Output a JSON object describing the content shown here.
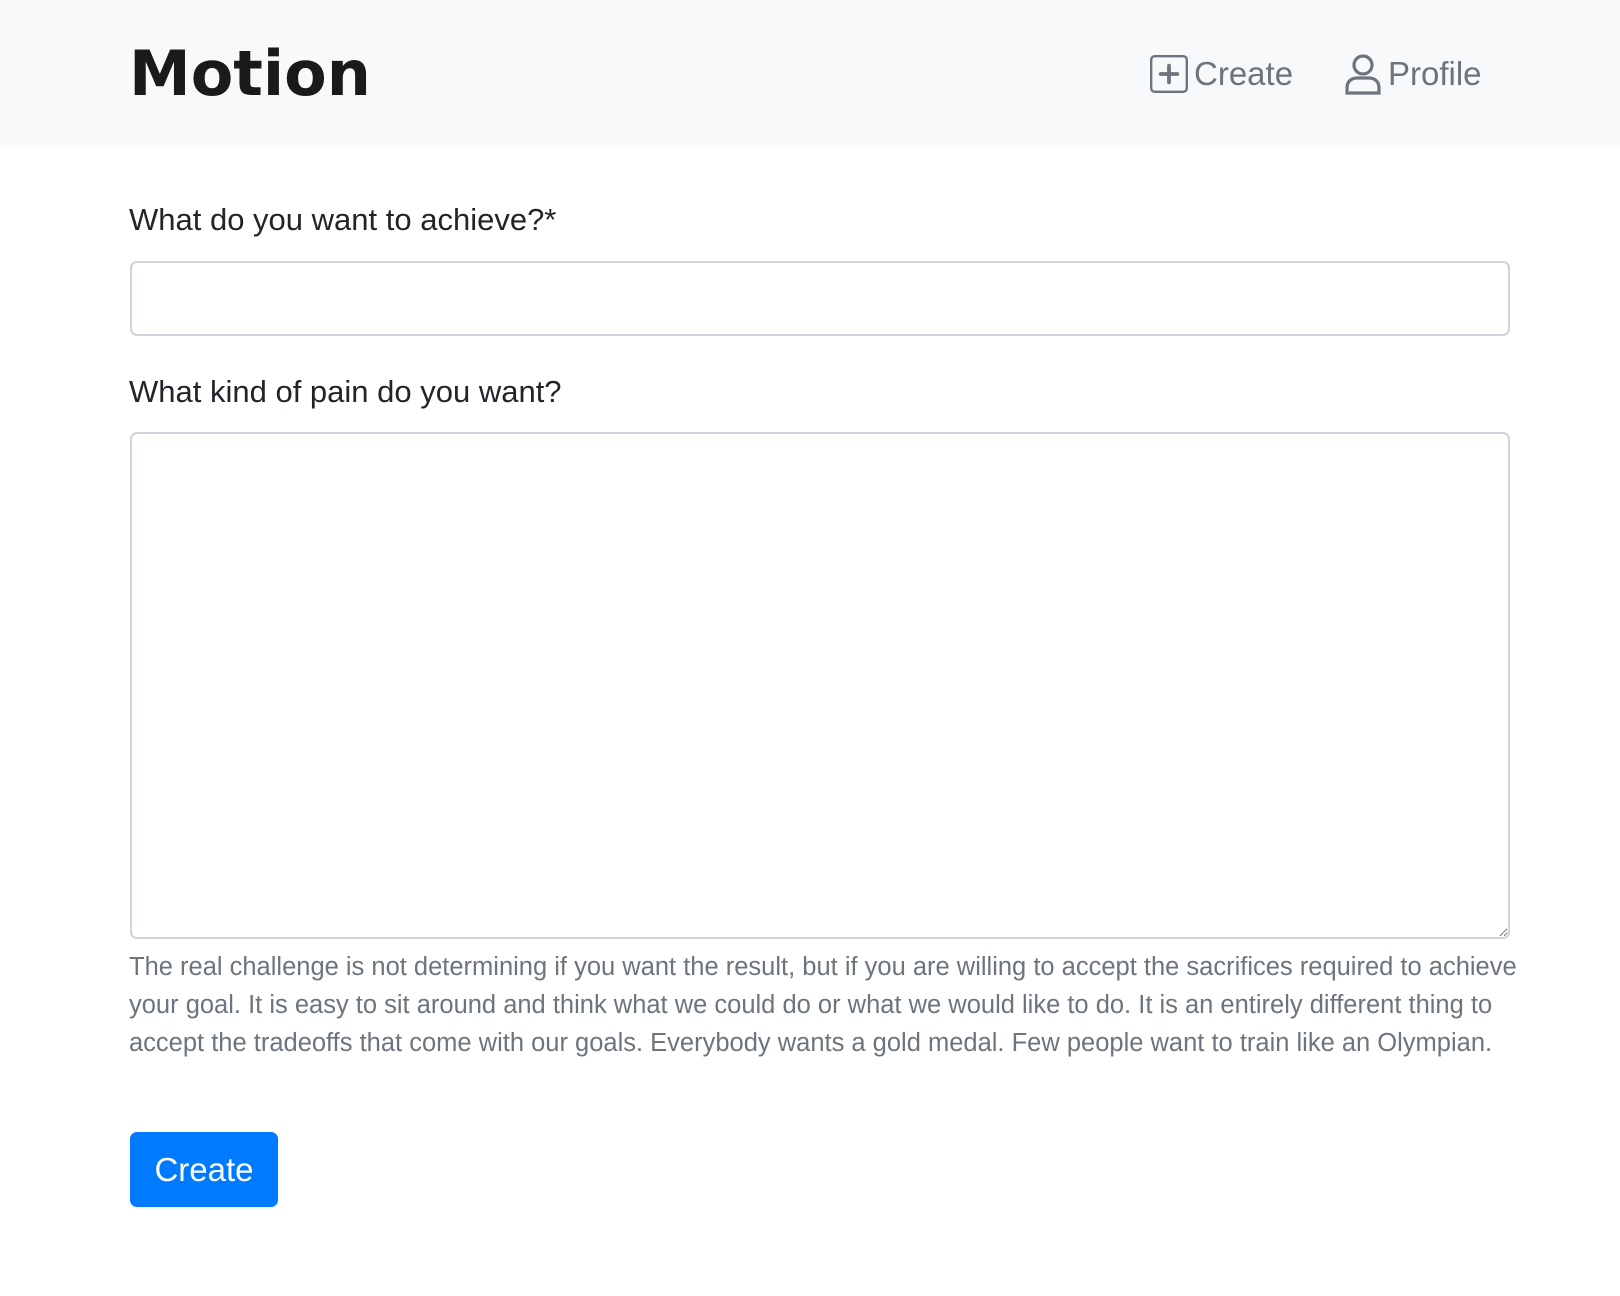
{
  "navbar": {
    "brand": "Motion",
    "links": [
      {
        "label": "Create",
        "icon": "plus-square-icon"
      },
      {
        "label": "Profile",
        "icon": "person-icon"
      }
    ]
  },
  "form": {
    "goal_label": "What do you want to achieve?*",
    "goal_value": "",
    "pain_label": "What kind of pain do you want?",
    "pain_value": "",
    "help_text": "The real challenge is not determining if you want the result, but if you are willing to accept the sacrifices required to achieve your goal. It is easy to sit around and think what we could do or what we would like to do. It is an entirely different thing to accept the tradeoffs that come with our goals. Everybody wants a gold medal. Few people want to train like an Olympian.",
    "submit_label": "Create"
  },
  "colors": {
    "navbar_bg": "#f8f9fa",
    "nav_link": "#6c757d",
    "primary": "#007bff",
    "border": "#ced4da"
  }
}
